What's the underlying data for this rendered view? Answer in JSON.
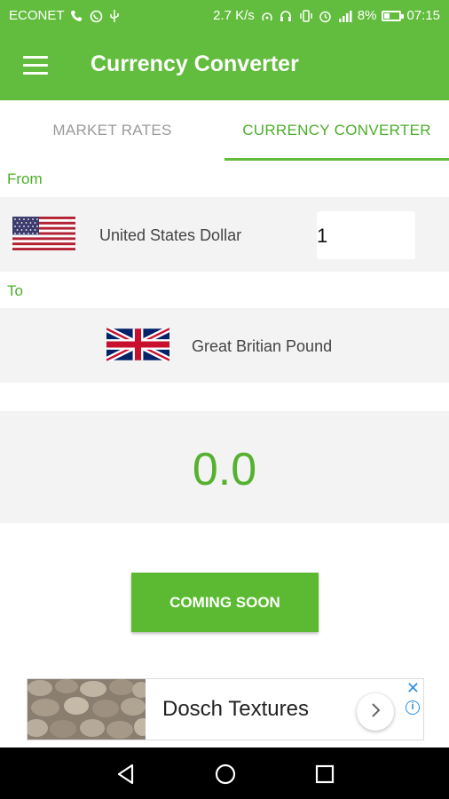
{
  "status_bar": {
    "carrier": "ECONET",
    "speed": "2.7 K/s",
    "battery": "8%",
    "time": "07:15",
    "icons": [
      "phone-icon",
      "whatsapp-icon",
      "usb-icon",
      "hotspot-icon",
      "headset-icon",
      "vibrate-icon",
      "alarm-icon",
      "signal-icon",
      "battery-icon"
    ]
  },
  "app_bar": {
    "title": "Currency Converter",
    "menu_icon": "hamburger-menu-icon"
  },
  "tabs": [
    {
      "label": "MARKET RATES",
      "active": false
    },
    {
      "label": "CURRENCY CONVERTER",
      "active": true
    }
  ],
  "from": {
    "label": "From",
    "currency": "United States Dollar",
    "flag": "us-flag",
    "amount": "1"
  },
  "to": {
    "label": "To",
    "currency": "Great Britian Pound",
    "flag": "uk-flag"
  },
  "result": {
    "value": "0.0"
  },
  "button": {
    "label": "COMING SOON"
  },
  "ad": {
    "title": "Dosch Textures",
    "close": "✕",
    "info": "i"
  },
  "colors": {
    "primary": "#62bc3d",
    "accent_text": "#4caf2b",
    "panel": "#f3f3f3",
    "tab_inactive": "#9a9a9a"
  }
}
